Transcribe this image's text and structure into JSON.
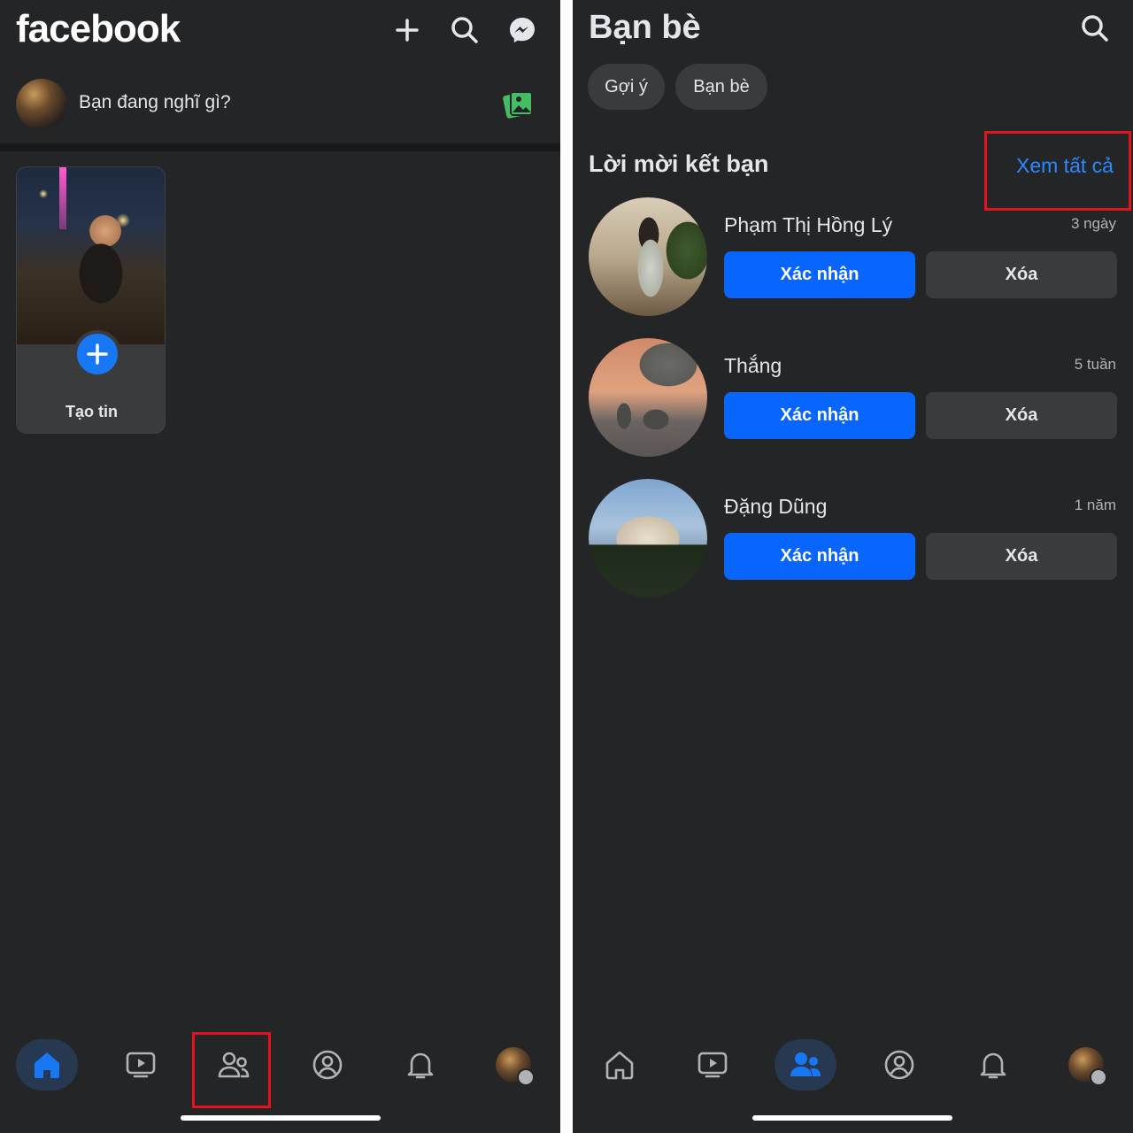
{
  "left": {
    "app_logo": "facebook",
    "header_icons": [
      "plus-icon",
      "search-icon",
      "messenger-icon"
    ],
    "composer": {
      "placeholder": "Bạn đang nghĩ gì?",
      "photo_icon": "photo-icon"
    },
    "story": {
      "label": "Tạo tin"
    },
    "nav": [
      "home-icon",
      "video-icon",
      "friends-icon",
      "profile-icon",
      "bell-icon",
      "menu-avatar"
    ],
    "active_nav": "home"
  },
  "right": {
    "title": "Bạn bè",
    "chips": [
      "Gợi ý",
      "Bạn bè"
    ],
    "section_title": "Lời mời kết bạn",
    "see_all": "Xem tất cả",
    "requests": [
      {
        "name": "Phạm Thị Hồng Lý",
        "time": "3 ngày",
        "confirm": "Xác nhận",
        "delete": "Xóa"
      },
      {
        "name": "Thắng",
        "time": "5 tuần",
        "confirm": "Xác nhận",
        "delete": "Xóa"
      },
      {
        "name": "Đặng Dũng",
        "time": "1 năm",
        "confirm": "Xác nhận",
        "delete": "Xóa"
      }
    ],
    "active_nav": "friends"
  },
  "colors": {
    "background": "#242526",
    "primary_blue": "#0866ff",
    "link_blue": "#2d88ff",
    "highlight_red": "#e0141e"
  }
}
